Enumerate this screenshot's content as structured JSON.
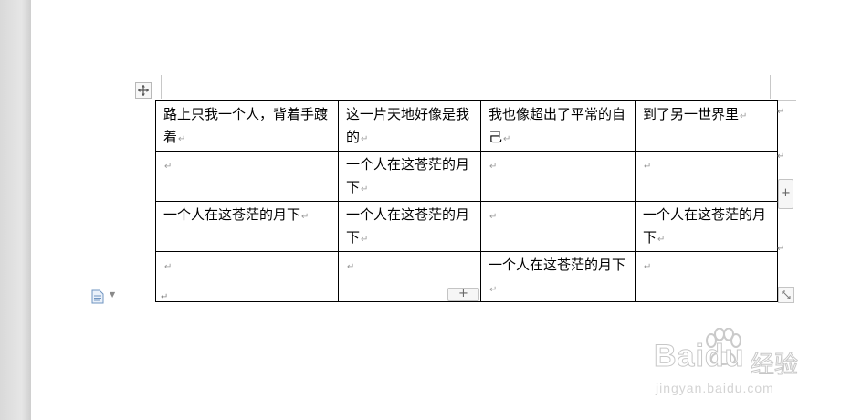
{
  "document": {
    "paragraph_mark": "↵",
    "table": {
      "rows": [
        [
          "路上只我一个人，背着手踱着",
          "这一片天地好像是我的",
          "我也像超出了平常的自己",
          "到了另一世界里"
        ],
        [
          "",
          "一个人在这苍茫的月下",
          "",
          ""
        ],
        [
          "一个人在这苍茫的月下",
          "一个人在这苍茫的月下",
          "",
          "一个人在这苍茫的月下"
        ],
        [
          "",
          "",
          "一个人在这苍茫的月下",
          ""
        ]
      ]
    },
    "add_row_label": "+",
    "add_column_label": "+"
  },
  "watermark": {
    "brand": "Baidu",
    "brand_cn": "经验",
    "url": "jingyan.baidu.com"
  }
}
